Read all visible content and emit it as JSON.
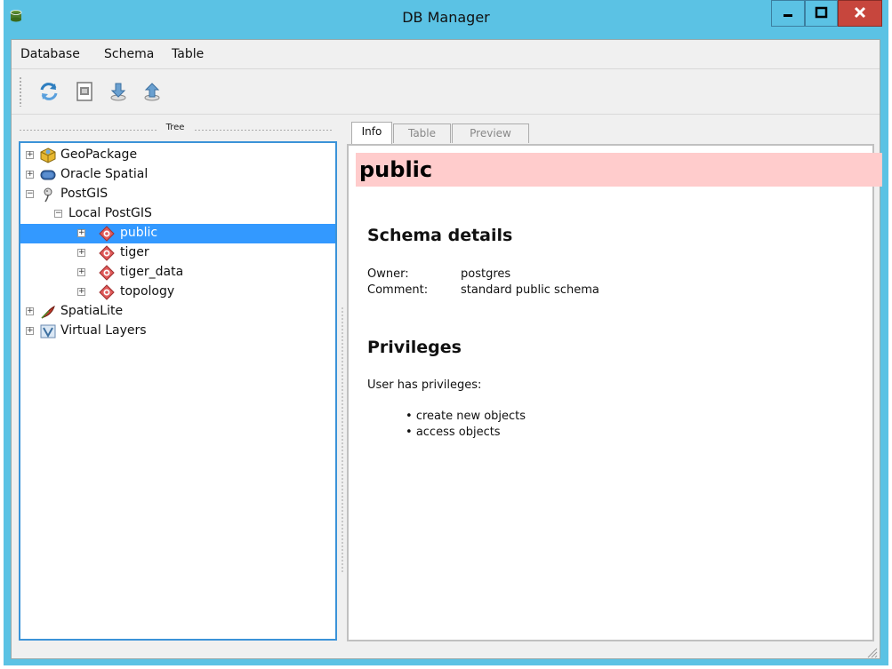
{
  "window": {
    "title": "DB Manager",
    "minimize_glyph": "▁",
    "maximize_glyph": "□",
    "close_glyph": "x"
  },
  "menu": [
    "Database",
    "Schema",
    "Table"
  ],
  "toolbar": [
    {
      "icon": "refresh-icon"
    },
    {
      "icon": "sql-window-icon"
    },
    {
      "icon": "import-layer-icon"
    },
    {
      "icon": "export-icon"
    }
  ],
  "dock": {
    "title": "Tree"
  },
  "tree": [
    {
      "label": "GeoPackage",
      "icon": "geopackage-icon",
      "level": 0,
      "expander": "+"
    },
    {
      "label": "Oracle Spatial",
      "icon": "oracle-icon",
      "level": 0,
      "expander": "+"
    },
    {
      "label": "PostGIS",
      "icon": "postgis-elephant-icon",
      "level": 0,
      "expander": "−"
    },
    {
      "label": "Local PostGIS",
      "icon": "",
      "level": 1,
      "expander": "−"
    },
    {
      "label": "public",
      "icon": "schema-icon",
      "level": 2,
      "expander": "+",
      "selected": true
    },
    {
      "label": "tiger",
      "icon": "schema-icon",
      "level": 2,
      "expander": "+"
    },
    {
      "label": "tiger_data",
      "icon": "schema-icon",
      "level": 2,
      "expander": "+"
    },
    {
      "label": "topology",
      "icon": "schema-icon",
      "level": 2,
      "expander": "+"
    },
    {
      "label": "SpatiaLite",
      "icon": "spatialite-feather-icon",
      "level": 0,
      "expander": "+"
    },
    {
      "label": "Virtual Layers",
      "icon": "virtual-layers-icon",
      "level": 0,
      "expander": "+"
    }
  ],
  "tabs": [
    {
      "label": "Info",
      "active": true
    },
    {
      "label": "Table",
      "active": false
    },
    {
      "label": "Preview",
      "active": false
    }
  ],
  "info": {
    "schema_name": "public",
    "details_heading": "Schema details",
    "owner_label": "Owner:",
    "owner_value": "postgres",
    "comment_label": "Comment:",
    "comment_value": "standard public schema",
    "privileges_heading": "Privileges",
    "privileges_intro": "User has privileges:",
    "privileges": [
      "create new objects",
      "access objects"
    ]
  },
  "colors": {
    "window_frame": "#5bc2e4",
    "selection": "#3399ff",
    "title_highlight": "#ffcccc",
    "schema_icon": "#e05a5a"
  }
}
